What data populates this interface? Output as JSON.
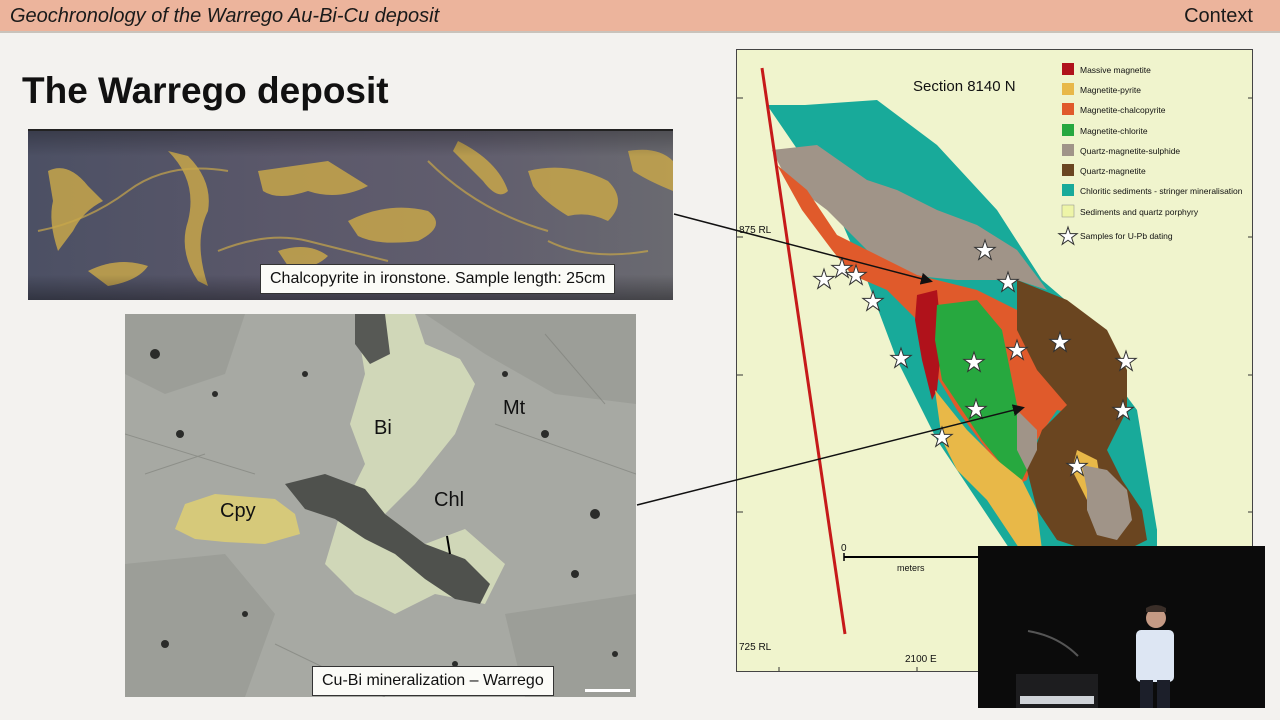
{
  "header": {
    "title": "Geochronology of the Warrego Au-Bi-Cu deposit",
    "section": "Context"
  },
  "slide": {
    "heading": "The Warrego deposit"
  },
  "core_photo": {
    "caption": "Chalcopyrite in ironstone. Sample length: 25cm"
  },
  "micrograph": {
    "caption": "Cu-Bi mineralization – Warrego",
    "labels": {
      "cpy": "Cpy",
      "bi": "Bi",
      "mt": "Mt",
      "chl": "Chl"
    }
  },
  "section_map": {
    "title": "Section 8140 N",
    "rl_top": "875 RL",
    "rl_bottom": "725 RL",
    "easting": "2100 E",
    "scale_zero": "0",
    "scale_unit": "meters",
    "legend": [
      {
        "label": "Massive magnetite",
        "color": "#b0121b"
      },
      {
        "label": "Magnetite-pyrite",
        "color": "#e8b848"
      },
      {
        "label": "Magnetite-chalcopyrite",
        "color": "#e05a2b"
      },
      {
        "label": "Magnetite-chlorite",
        "color": "#27a83f"
      },
      {
        "label": "Quartz-magnetite-sulphide",
        "color": "#a09488"
      },
      {
        "label": "Quartz-magnetite",
        "color": "#6a4520"
      },
      {
        "label": "Chloritic sediments - stringer mineralisation",
        "color": "#18aa9a"
      },
      {
        "label": "Sediments and quartz porphyry",
        "color": "#eef5a8"
      }
    ],
    "legend_star": "Samples for U-Pb dating"
  }
}
